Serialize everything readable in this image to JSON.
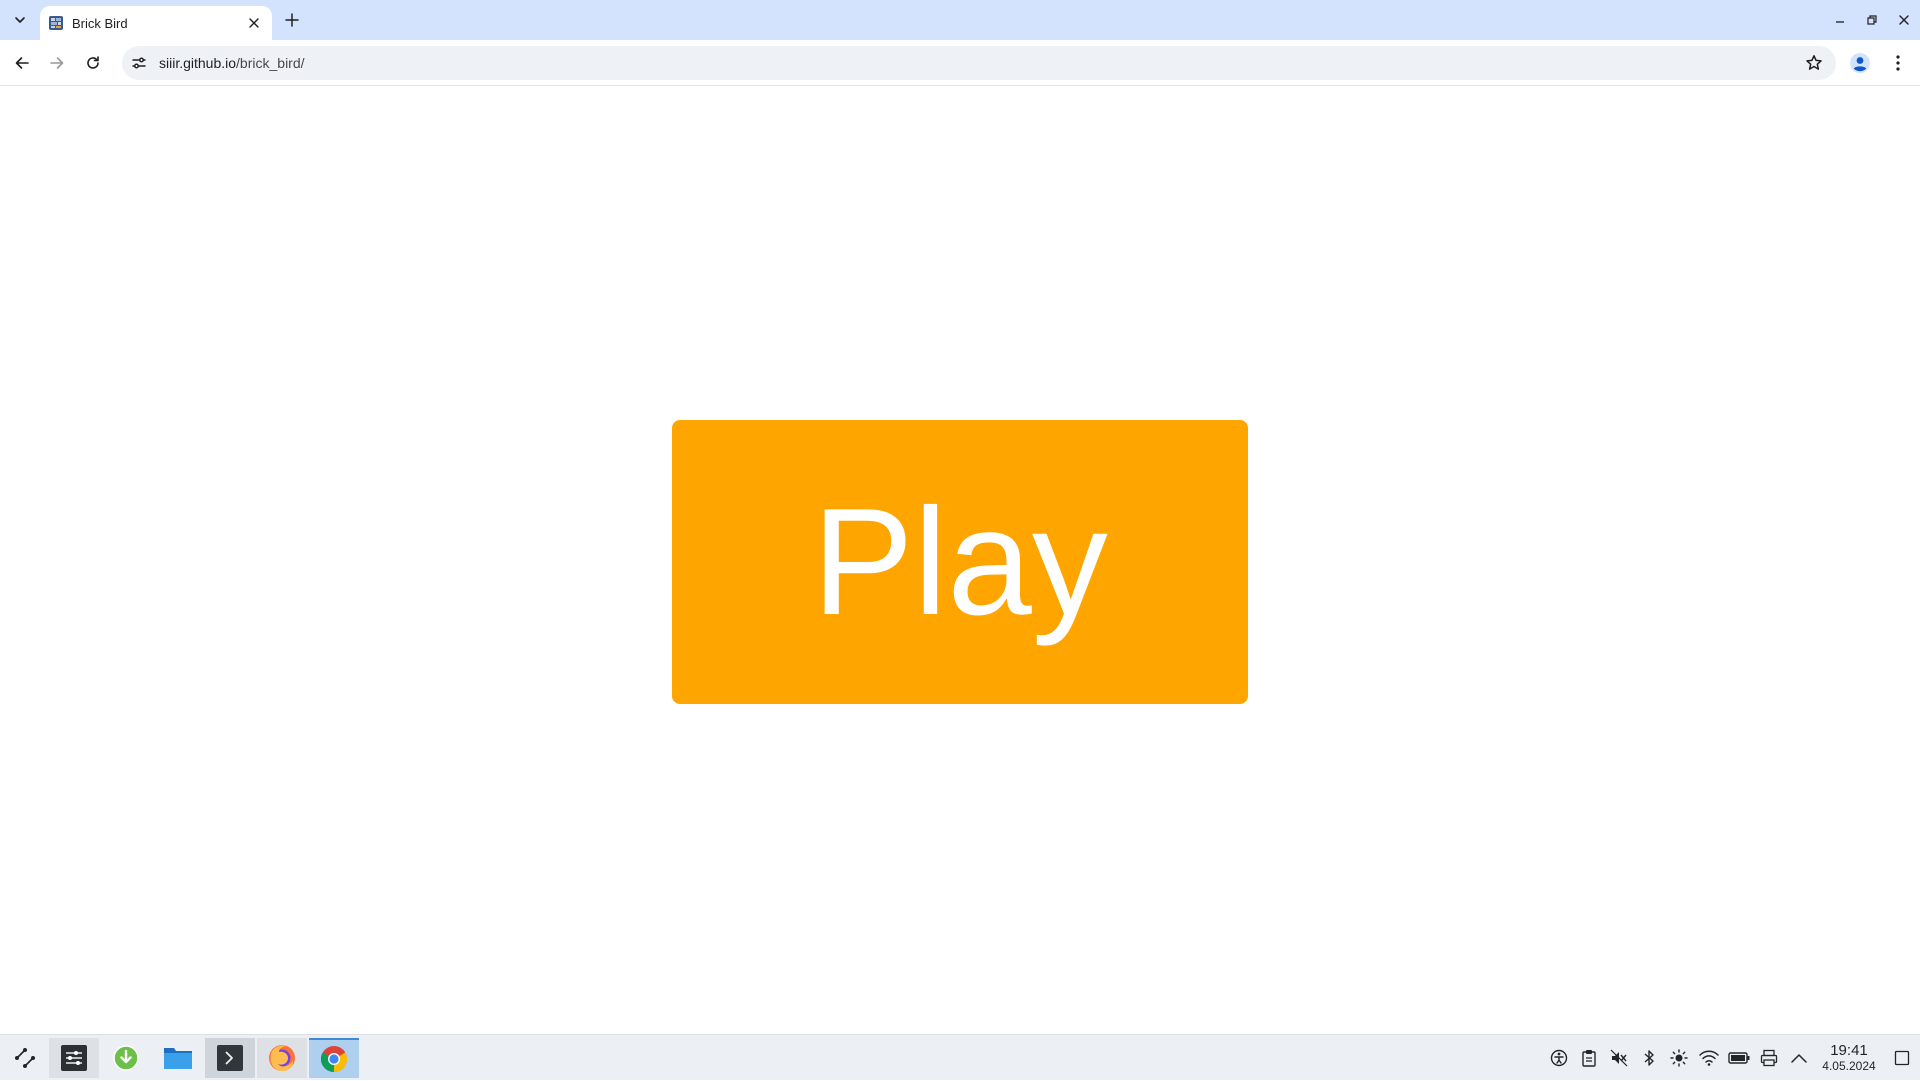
{
  "browser": {
    "tab": {
      "title": "Brick Bird",
      "favicon": "brick-bird-favicon"
    },
    "url": {
      "host": "siiir.github.io",
      "path": "/brick_bird/"
    },
    "icons": {
      "tab_search": "chevron-down-icon",
      "tab_close": "close-icon",
      "new_tab": "plus-icon",
      "minimize": "minimize-icon",
      "restore": "restore-icon",
      "close_window": "close-icon",
      "back": "arrow-left-icon",
      "forward": "arrow-right-icon",
      "reload": "reload-icon",
      "site_info": "tune-icon",
      "bookmark": "star-icon",
      "profile": "person-icon",
      "menu": "kebab-menu-icon"
    }
  },
  "page": {
    "play_label": "Play",
    "play_color": "#ffa500",
    "play_text_color": "#ffffff"
  },
  "taskbar": {
    "apps": [
      "app-launcher-icon",
      "system-settings-icon",
      "download-manager-icon",
      "file-manager-icon",
      "terminal-icon",
      "firefox-icon",
      "chrome-icon"
    ],
    "tray": [
      "accessibility-icon",
      "clipboard-icon",
      "volume-muted-icon",
      "bluetooth-icon",
      "brightness-icon",
      "wifi-icon",
      "battery-icon",
      "printer-icon",
      "chevron-up-icon"
    ],
    "clock": {
      "time": "19:41",
      "date": "4.05.2024"
    }
  }
}
